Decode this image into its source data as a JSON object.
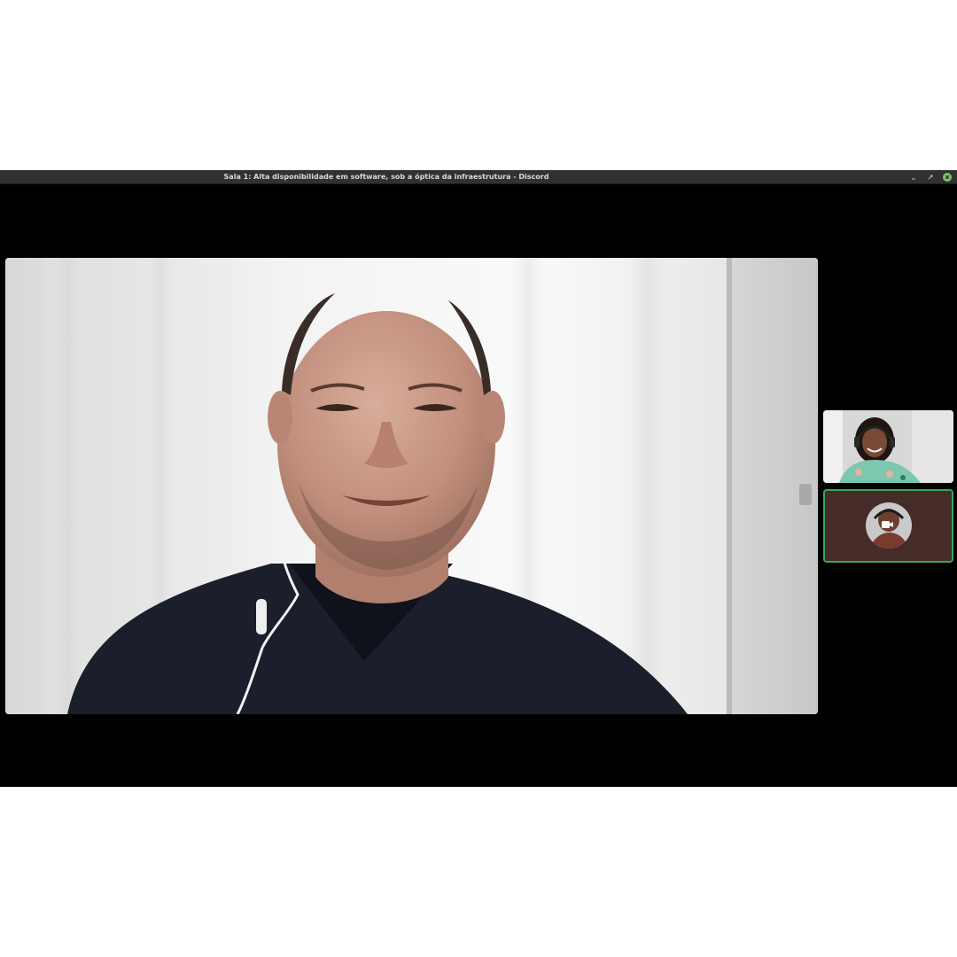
{
  "window": {
    "title": "Sala 1: Alta disponibilidade em software, sob a óptica da infraestrutura - Discord",
    "controls": [
      {
        "name": "minimize",
        "icon": "minimize-icon"
      },
      {
        "name": "restore",
        "icon": "restore-icon"
      },
      {
        "name": "close",
        "icon": "close-icon"
      }
    ]
  },
  "call": {
    "main_participant": {
      "type": "video",
      "icon": "participant-video-feed"
    },
    "side_participants": [
      {
        "type": "video",
        "icon": "participant-video-feed"
      },
      {
        "type": "avatar",
        "icon": "video-camera-icon",
        "speaking": true
      }
    ]
  },
  "colors": {
    "titlebar_bg": "#2f3133",
    "titlebar_text": "#dadada",
    "close_button": "#7fbf6a",
    "window_bg": "#000000",
    "speaking_ring": "#3ba55d",
    "avatar_tile_bg": "#452c28"
  }
}
